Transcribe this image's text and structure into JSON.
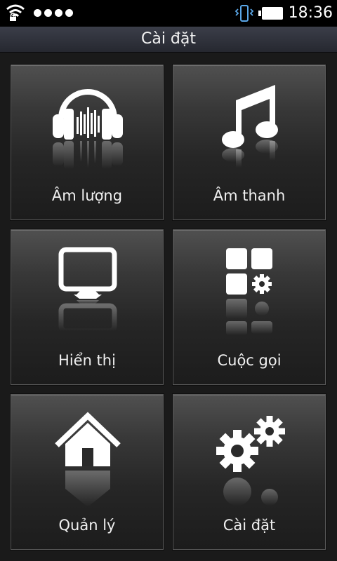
{
  "status_bar": {
    "time": "18:36",
    "icons": [
      "wifi-icon",
      "signal-dots-icon",
      "vibrate-icon",
      "battery-icon"
    ]
  },
  "title": "Cài đặt",
  "tiles": [
    {
      "label": "Âm lượng",
      "icon": "headphones-icon"
    },
    {
      "label": "Âm thanh",
      "icon": "music-note-icon"
    },
    {
      "label": "Hiển thị",
      "icon": "monitor-icon"
    },
    {
      "label": "Cuộc gọi",
      "icon": "apps-gear-icon"
    },
    {
      "label": "Quản lý",
      "icon": "home-icon"
    },
    {
      "label": "Cài đặt",
      "icon": "gears-icon"
    }
  ],
  "colors": {
    "background": "#1a1a1a",
    "title_bar": "#30333c",
    "tile_top": "#505050",
    "tile_bottom": "#1c1c1c"
  }
}
